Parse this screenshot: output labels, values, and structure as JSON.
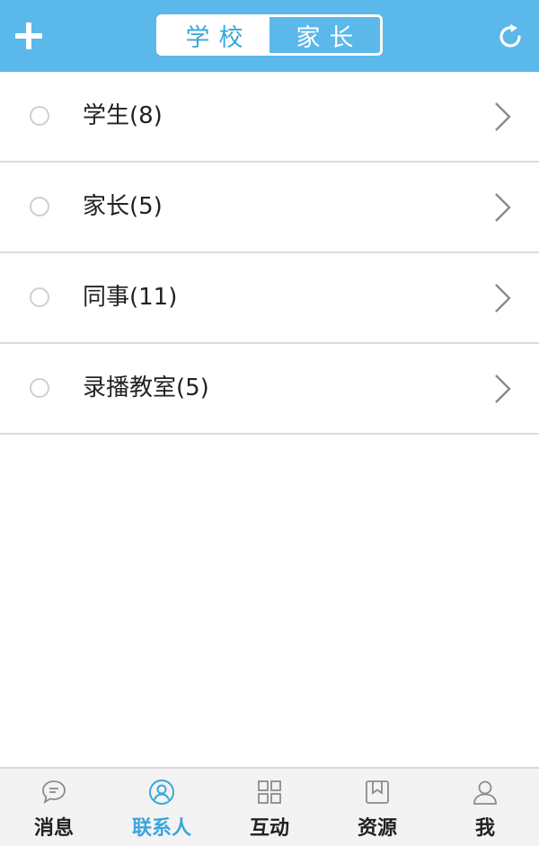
{
  "header": {
    "add_icon": "plus-icon",
    "refresh_icon": "refresh-icon",
    "segments": [
      {
        "label": "学校",
        "active": true
      },
      {
        "label": "家长",
        "active": false
      }
    ]
  },
  "contacts": [
    {
      "label": "学生(8)"
    },
    {
      "label": "家长(5)"
    },
    {
      "label": "同事(11)"
    },
    {
      "label": "录播教室(5)"
    }
  ],
  "tabbar": {
    "tabs": [
      {
        "label": "消息",
        "icon": "chat-bubble-icon",
        "active": false
      },
      {
        "label": "联系人",
        "icon": "contacts-icon",
        "active": true
      },
      {
        "label": "互动",
        "icon": "grid-icon",
        "active": false
      },
      {
        "label": "资源",
        "icon": "bookmark-box-icon",
        "active": false
      },
      {
        "label": "我",
        "icon": "person-icon",
        "active": false
      }
    ]
  },
  "colors": {
    "header_bg": "#5bb8ea",
    "accent": "#3aa6dc",
    "tabbar_bg": "#f3f3f3",
    "divider": "#dcdcdc"
  }
}
